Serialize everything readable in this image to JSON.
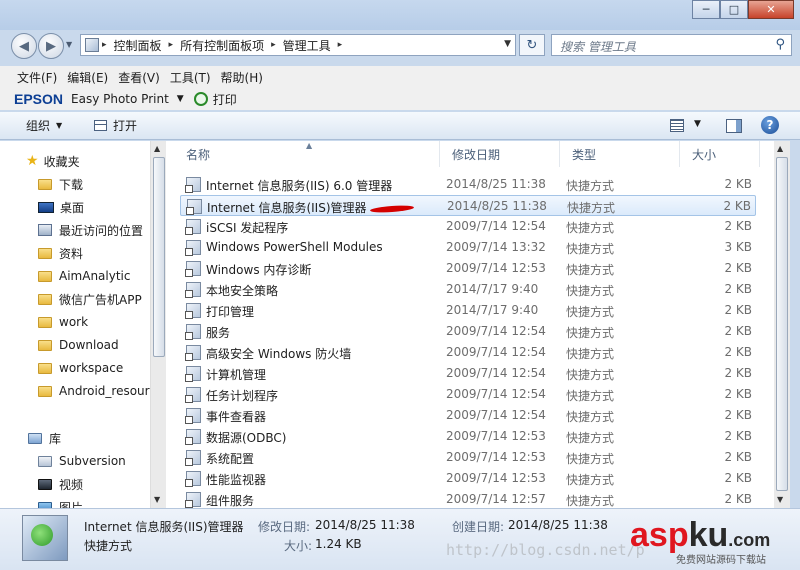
{
  "window": {
    "minimize": "─",
    "maximize": "□",
    "close": "✕"
  },
  "nav": {
    "back": "◀",
    "forward": "▶",
    "breadcrumb": [
      "控制面板",
      "所有控制面板项",
      "管理工具"
    ],
    "search_placeholder": "搜索 管理工具"
  },
  "menu": [
    "文件(F)",
    "编辑(E)",
    "查看(V)",
    "工具(T)",
    "帮助(H)"
  ],
  "epson": {
    "brand": "EPSON",
    "app": "Easy Photo Print",
    "print": "打印"
  },
  "commands": {
    "organize": "组织",
    "open": "打开",
    "help": "?"
  },
  "sidebar": {
    "favorites": "收藏夹",
    "items": [
      "下载",
      "桌面",
      "最近访问的位置",
      "资料",
      "AimAnalytic",
      "微信广告机APP",
      "work",
      "Download",
      "workspace",
      "Android_resour"
    ],
    "library": "库",
    "lib_items": [
      "Subversion",
      "视频",
      "图片"
    ]
  },
  "columns": {
    "name": "名称",
    "date": "修改日期",
    "type": "类型",
    "size": "大小"
  },
  "files": [
    {
      "name": "Internet 信息服务(IIS) 6.0 管理器",
      "date": "2014/8/25 11:38",
      "type": "快捷方式",
      "size": "2 KB"
    },
    {
      "name": "Internet 信息服务(IIS)管理器",
      "date": "2014/8/25 11:38",
      "type": "快捷方式",
      "size": "2 KB"
    },
    {
      "name": "iSCSI 发起程序",
      "date": "2009/7/14 12:54",
      "type": "快捷方式",
      "size": "2 KB"
    },
    {
      "name": "Windows PowerShell Modules",
      "date": "2009/7/14 13:32",
      "type": "快捷方式",
      "size": "3 KB"
    },
    {
      "name": "Windows 内存诊断",
      "date": "2009/7/14 12:53",
      "type": "快捷方式",
      "size": "2 KB"
    },
    {
      "name": "本地安全策略",
      "date": "2014/7/17 9:40",
      "type": "快捷方式",
      "size": "2 KB"
    },
    {
      "name": "打印管理",
      "date": "2014/7/17 9:40",
      "type": "快捷方式",
      "size": "2 KB"
    },
    {
      "name": "服务",
      "date": "2009/7/14 12:54",
      "type": "快捷方式",
      "size": "2 KB"
    },
    {
      "name": "高级安全 Windows 防火墙",
      "date": "2009/7/14 12:54",
      "type": "快捷方式",
      "size": "2 KB"
    },
    {
      "name": "计算机管理",
      "date": "2009/7/14 12:54",
      "type": "快捷方式",
      "size": "2 KB"
    },
    {
      "name": "任务计划程序",
      "date": "2009/7/14 12:54",
      "type": "快捷方式",
      "size": "2 KB"
    },
    {
      "name": "事件查看器",
      "date": "2009/7/14 12:54",
      "type": "快捷方式",
      "size": "2 KB"
    },
    {
      "name": "数据源(ODBC)",
      "date": "2009/7/14 12:53",
      "type": "快捷方式",
      "size": "2 KB"
    },
    {
      "name": "系统配置",
      "date": "2009/7/14 12:53",
      "type": "快捷方式",
      "size": "2 KB"
    },
    {
      "name": "性能监视器",
      "date": "2009/7/14 12:53",
      "type": "快捷方式",
      "size": "2 KB"
    },
    {
      "name": "组件服务",
      "date": "2009/7/14 12:57",
      "type": "快捷方式",
      "size": "2 KB"
    }
  ],
  "details": {
    "name": "Internet 信息服务(IIS)管理器",
    "type": "快捷方式",
    "modified_label": "修改日期:",
    "modified": "2014/8/25 11:38",
    "created_label": "创建日期:",
    "created": "2014/8/25 11:38",
    "size_label": "大小:",
    "size": "1.24 KB"
  },
  "watermark": {
    "url": "http://blog.csdn.net/p",
    "logo_a": "asp",
    "logo_b": "ku",
    "logo_c": ".com",
    "sub": "免费网站源码下载站"
  }
}
